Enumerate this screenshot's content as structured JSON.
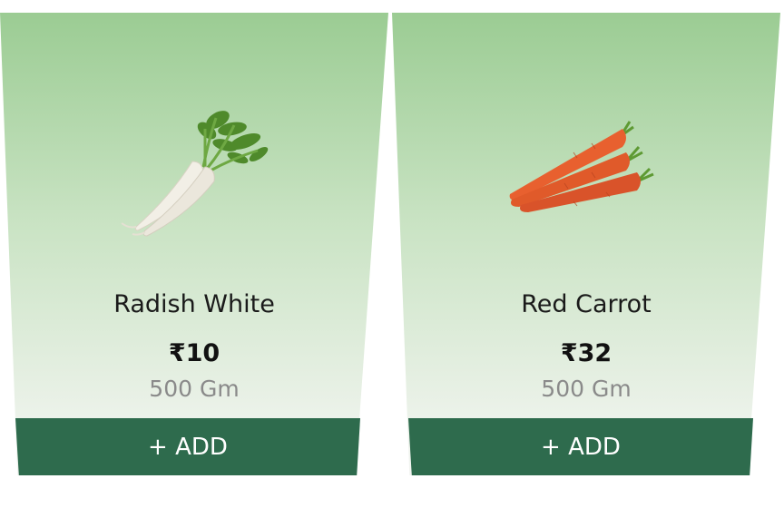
{
  "products": [
    {
      "name": "Radish White",
      "price": "₹10",
      "unit": "500 Gm",
      "add_label": "+ ADD",
      "image_icon": "radish-image"
    },
    {
      "name": "Red Carrot",
      "price": "₹32",
      "unit": "500 Gm",
      "add_label": "+ ADD",
      "image_icon": "carrot-image"
    }
  ],
  "colors": {
    "card_top": "#9bcc93",
    "card_bottom": "#f2f4f1",
    "button": "#2e6b4d",
    "unit_text": "#8a8a8a"
  }
}
